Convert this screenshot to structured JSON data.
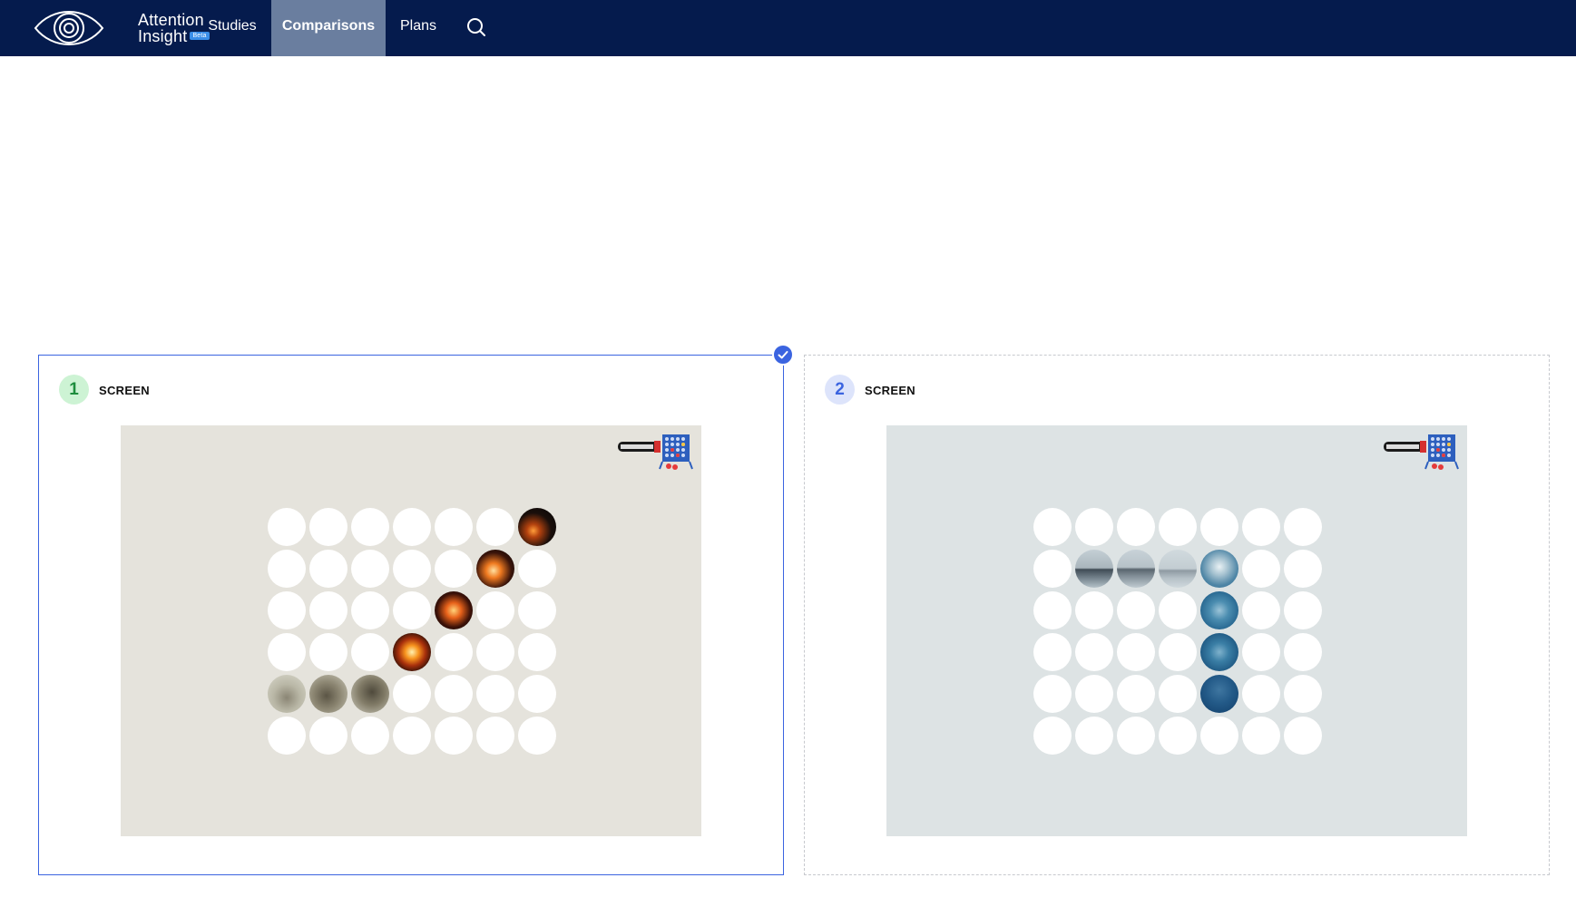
{
  "app": {
    "logo_line1": "Attention",
    "logo_line2": "Insight",
    "logo_badge": "Beta"
  },
  "nav": {
    "items": [
      {
        "label": "Studies"
      },
      {
        "label": "Comparisons",
        "active": true
      },
      {
        "label": "Plans"
      }
    ],
    "search_icon": "search-icon"
  },
  "cards": [
    {
      "number": "1",
      "label": "SCREEN",
      "selected": true,
      "badge_color": "#1d8d3d",
      "background": "#e5e3dc",
      "theme": "dinosaur meteor"
    },
    {
      "number": "2",
      "label": "SCREEN",
      "selected": false,
      "badge_color": "#3b64e0",
      "background": "#dde3e4",
      "theme": "titanic iceberg"
    }
  ],
  "thumbnail_logo": "CONNECT 4",
  "colors": {
    "nav_bg": "#051b4d",
    "nav_active": "#6a7e9f",
    "accent": "#3b64e0"
  }
}
